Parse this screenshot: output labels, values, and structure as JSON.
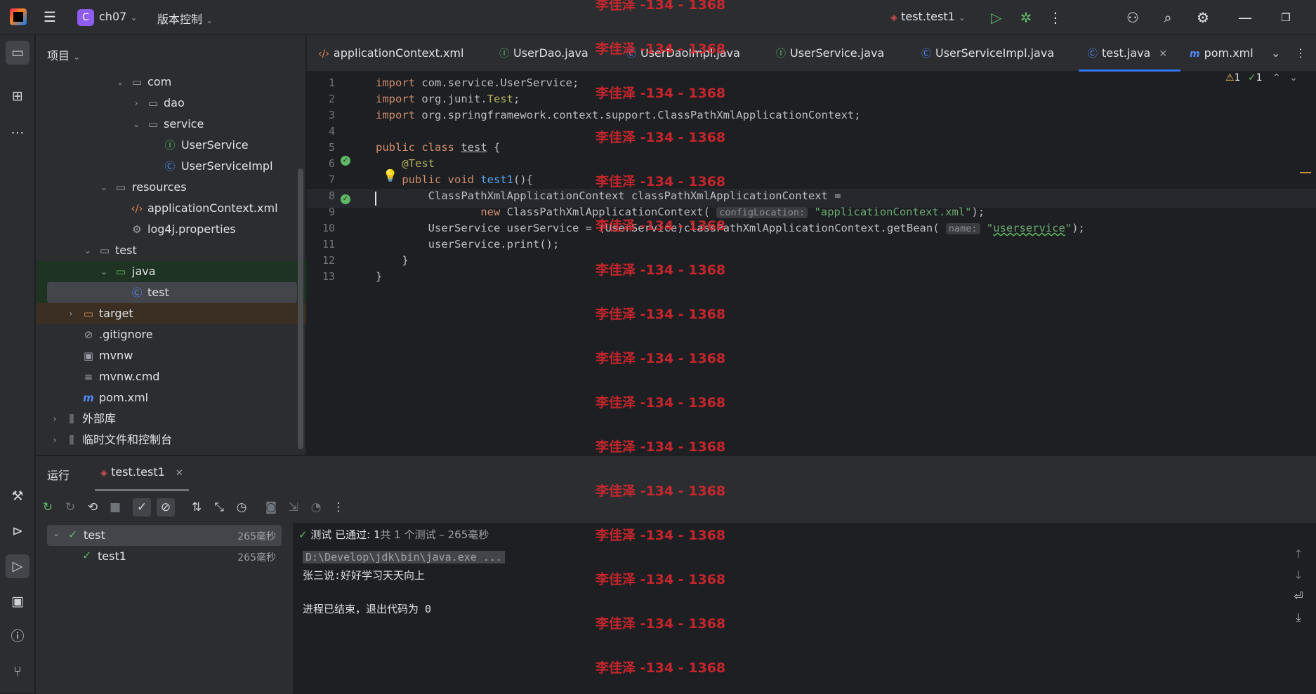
{
  "titlebar": {
    "project_badge": "C",
    "project_name": "ch07",
    "vcs_label": "版本控制",
    "run_config": "test.test1"
  },
  "watermark": "李佳泽 -134 - 1368",
  "project_panel": {
    "header": "项目",
    "tree": [
      {
        "label": "com",
        "icon": "folder-package-icon"
      },
      {
        "label": "dao",
        "icon": "folder-package-icon"
      },
      {
        "label": "service",
        "icon": "folder-package-icon"
      },
      {
        "label": "UserService",
        "icon": "interface-icon"
      },
      {
        "label": "UserServiceImpl",
        "icon": "class-icon"
      },
      {
        "label": "resources",
        "icon": "folder-resources-icon"
      },
      {
        "label": "applicationContext.xml",
        "icon": "xml-icon"
      },
      {
        "label": "log4j.properties",
        "icon": "properties-icon"
      },
      {
        "label": "test",
        "icon": "folder-icon"
      },
      {
        "label": "java",
        "icon": "folder-test-icon"
      },
      {
        "label": "test",
        "icon": "class-icon"
      },
      {
        "label": "target",
        "icon": "folder-excluded-icon"
      },
      {
        "label": ".gitignore",
        "icon": "ignore-icon"
      },
      {
        "label": "mvnw",
        "icon": "terminal-icon"
      },
      {
        "label": "mvnw.cmd",
        "icon": "text-file-icon"
      },
      {
        "label": "pom.xml",
        "icon": "maven-icon"
      },
      {
        "label": "外部库",
        "icon": "library-icon"
      },
      {
        "label": "临时文件和控制台",
        "icon": "scratch-icon"
      }
    ]
  },
  "tabs": [
    {
      "label": "applicationContext.xml"
    },
    {
      "label": "UserDao.java"
    },
    {
      "label": "UserDaoImpl.java"
    },
    {
      "label": "UserService.java"
    },
    {
      "label": "UserServiceImpl.java"
    },
    {
      "label": "test.java"
    },
    {
      "label": "pom.xml"
    }
  ],
  "editor": {
    "inspections": {
      "warnings": "1",
      "ok": "1"
    },
    "line_numbers": [
      "1",
      "2",
      "3",
      "4",
      "5",
      "6",
      "7",
      "8",
      "9",
      "10",
      "11",
      "12",
      "13"
    ],
    "hints": {
      "configLocation": "configLocation:",
      "name": "name:"
    }
  },
  "run_panel": {
    "tab_run": "运行",
    "tab_config": "test.test1",
    "tests": [
      {
        "name": "test",
        "time": "265毫秒"
      },
      {
        "name": "test1",
        "time": "265毫秒"
      }
    ],
    "status_passed": "测试 已通过: 1",
    "status_total": "共 1 个测试 – 265毫秒",
    "console": [
      "D:\\Develop\\jdk\\bin\\java.exe ...",
      "张三说:好好学习天天向上",
      "",
      "进程已结束，退出代码为 0"
    ]
  }
}
